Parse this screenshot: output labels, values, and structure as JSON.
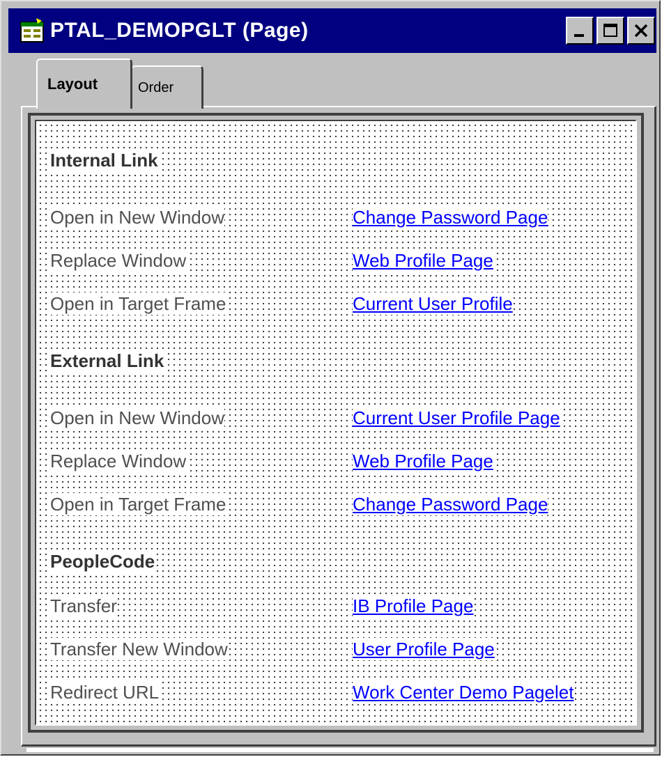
{
  "window": {
    "title": "PTAL_DEMOPGLT (Page)",
    "icon": "page-definition-icon",
    "controls": {
      "minimize": "minimize-icon",
      "maximize": "maximize-icon",
      "close": "close-icon"
    }
  },
  "tabs": [
    {
      "label": "Layout",
      "active": true
    },
    {
      "label": "Order",
      "active": false
    }
  ],
  "sections": {
    "internal": {
      "heading": "Internal Link",
      "rows": [
        {
          "label": "Open in New Window",
          "link": "Change Password Page"
        },
        {
          "label": "Replace Window",
          "link": "Web Profile Page"
        },
        {
          "label": "Open in Target Frame",
          "link": "Current User Profile"
        }
      ]
    },
    "external": {
      "heading": "External Link",
      "rows": [
        {
          "label": "Open in New Window",
          "link": "Current User Profile Page"
        },
        {
          "label": "Replace Window",
          "link": "Web Profile Page"
        },
        {
          "label": "Open in Target Frame",
          "link": "Change Password Page"
        }
      ]
    },
    "peoplecode": {
      "heading": "PeopleCode",
      "rows": [
        {
          "label": "Transfer",
          "link": "IB Profile Page"
        },
        {
          "label": "Transfer New Window",
          "link": "User Profile Page"
        },
        {
          "label": "Redirect URL",
          "link": "Work Center Demo Pagelet"
        }
      ]
    }
  },
  "colors": {
    "titlebar": "#000080",
    "link": "#0000ff",
    "chrome": "#c0c0c0"
  }
}
